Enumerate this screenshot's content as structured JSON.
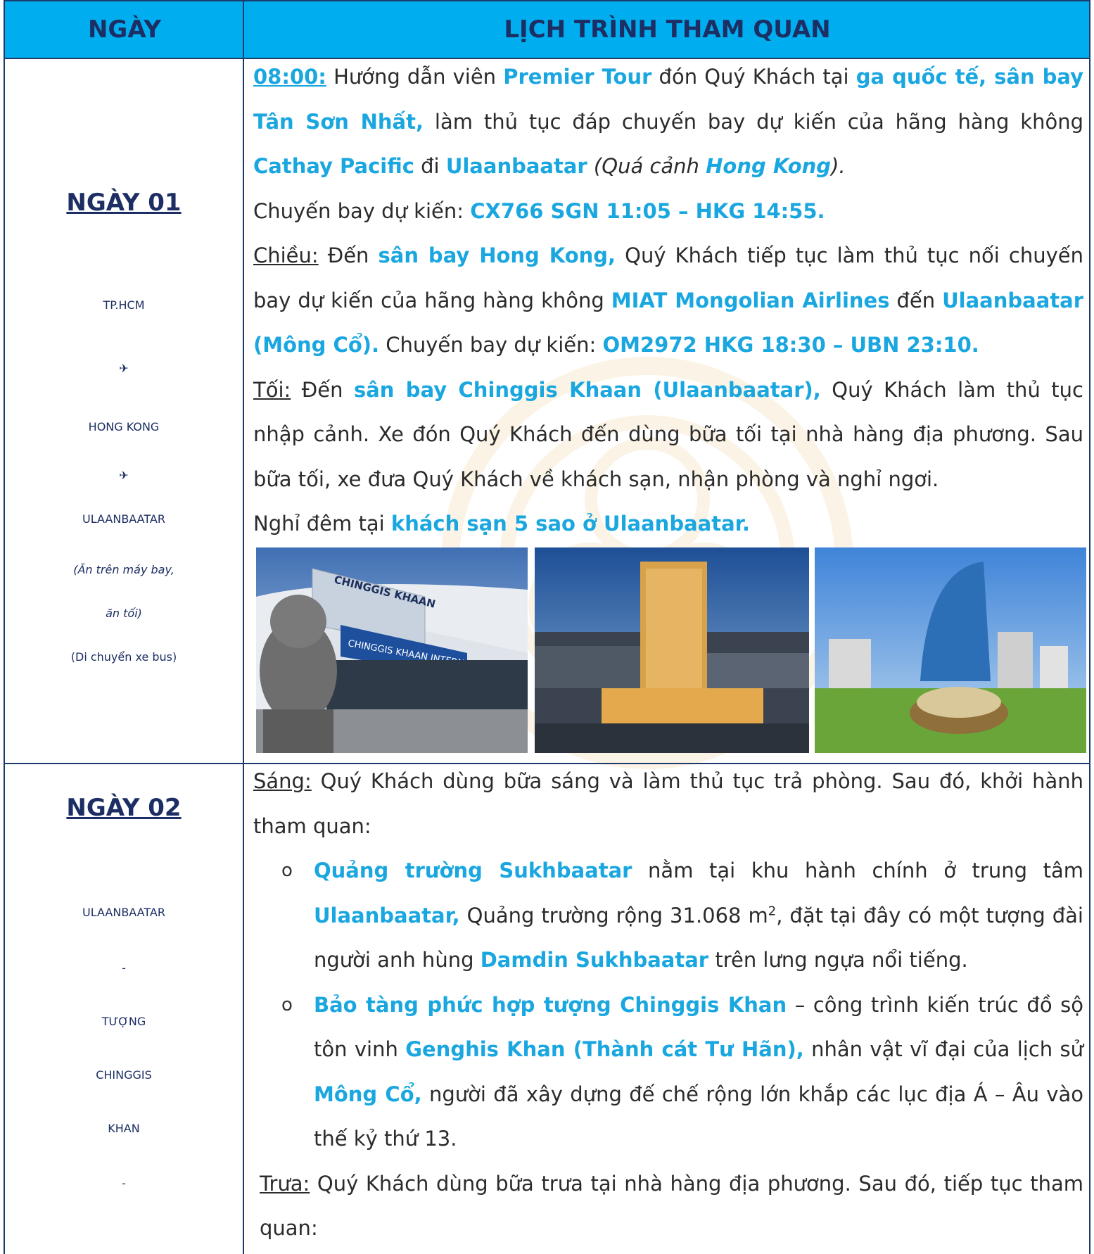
{
  "header": {
    "day_col": "NGÀY",
    "schedule_col": "LỊCH TRÌNH THAM QUAN"
  },
  "day1": {
    "title": "NGÀY 01",
    "route": [
      "TP.HCM",
      "✈",
      "HONG KONG",
      "✈",
      "ULAANBAATAR"
    ],
    "meals_line1": "(Ăn trên máy bay,",
    "meals_line2": "ăn tối)",
    "transport": "(Di chuyển xe bus)",
    "p1": {
      "time": "08:00:",
      "t1": " Hướng dẫn viên ",
      "h1": "Premier Tour",
      "t2": " đón Quý Khách tại ",
      "h2": "ga quốc tế, sân bay Tân Sơn Nhất,",
      "t3": " làm thủ tục đáp chuyến bay dự kiến của hãng hàng không ",
      "h3": "Cathay Pacific",
      "t4": " đi ",
      "h4": "Ulaanbaatar",
      "t5": " (Quá cảnh ",
      "h5": "Hong Kong",
      "t6": ")."
    },
    "p2": {
      "t1": "Chuyến bay dự kiến: ",
      "h1": "CX766 SGN 11:05 – HKG 14:55."
    },
    "p3": {
      "label": "Chiều:",
      "t1": " Đến ",
      "h1": "sân bay Hong Kong,",
      "t2": " Quý Khách tiếp tục làm thủ tục nối chuyến bay dự kiến của hãng hàng không ",
      "h2": "MIAT Mongolian Airlines",
      "t3": " đến ",
      "h3": "Ulaanbaatar (Mông Cổ).",
      "t4": " Chuyến bay dự kiến: ",
      "h4": "OM2972 HKG 18:30 – UBN 23:10."
    },
    "p4": {
      "label": "Tối:",
      "t1": " Đến ",
      "h1": "sân bay Chinggis Khaan (Ulaanbaatar),",
      "t2": " Quý Khách làm thủ tục nhập cảnh. Xe đón Quý Khách đến dùng bữa tối tại nhà hàng địa phương. Sau bữa tối, xe đưa Quý Khách về khách sạn, nhận phòng và nghỉ ngơi."
    },
    "p5": {
      "t1": "Nghỉ đêm tại ",
      "h1": "khách sạn 5 sao ở Ulaanbaatar."
    },
    "photo1_sign": "CHINGGIS KHAAN INTERNATIONAL AIRPORT",
    "photo1_sign_top": "CHINGGIS KHAAN"
  },
  "day2": {
    "title": "NGÀY 02",
    "route": [
      "ULAANBAATAR",
      "-",
      "TƯỢNG",
      "CHINGGIS",
      "KHAN",
      "-"
    ],
    "p1": {
      "label": "Sáng:",
      "t1": " Quý Khách dùng bữa sáng và làm thủ tục trả phòng. Sau đó, khởi hành tham quan:"
    },
    "b1": {
      "mark": "o",
      "h1": "Quảng trường Sukhbaatar",
      "t1": " nằm tại khu hành chính ở trung tâm ",
      "h2": "Ulaanbaatar,",
      "t2": " Quảng trường rộng 31.068 m",
      "sup": "2",
      "t3": ", đặt tại đây có một tượng đài người anh hùng ",
      "h3": "Damdin Sukhbaatar",
      "t4": " trên lưng ngựa nổi tiếng."
    },
    "b2": {
      "mark": "o",
      "h1": "Bảo tàng phức hợp tượng Chinggis Khan",
      "t1": " – công trình kiến trúc đồ sộ tôn vinh ",
      "h2": "Genghis Khan (Thành cát Tư Hãn),",
      "t2": " nhân vật vĩ đại của lịch sử ",
      "h3": "Mông Cổ,",
      "t3": " người đã xây dựng đế chế rộng lớn khắp các lục địa Á – Âu vào thế kỷ thứ 13."
    },
    "p2": {
      "label": "Trưa:",
      "t1": " Quý Khách dùng bữa trưa tại nhà hàng địa phương. Sau đó, tiếp tục tham quan:"
    }
  },
  "colors": {
    "header_bg": "#00aeef",
    "header_text": "#1c2e63",
    "highlight": "#1aa7e0",
    "border": "#1c3a6b"
  }
}
